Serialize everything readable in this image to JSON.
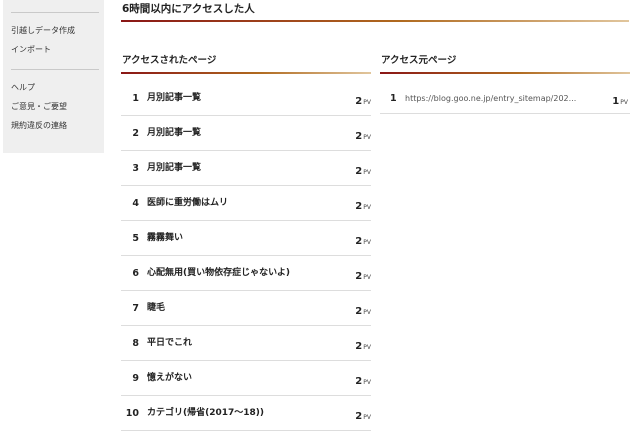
{
  "sidebar": {
    "items": [
      {
        "label": "引越しデータ作成"
      },
      {
        "label": "インポート"
      },
      {
        "label": "ヘルプ"
      },
      {
        "label": "ご意見・ご要望"
      },
      {
        "label": "規約違反の連絡"
      }
    ]
  },
  "header": {
    "title": "6時間以内にアクセスした人"
  },
  "accessed_pages": {
    "title": "アクセスされたページ",
    "rows": [
      {
        "rank": "1",
        "name": "月別記事一覧",
        "pv": "2",
        "unit": "PV"
      },
      {
        "rank": "2",
        "name": "月別記事一覧",
        "pv": "2",
        "unit": "PV"
      },
      {
        "rank": "3",
        "name": "月別記事一覧",
        "pv": "2",
        "unit": "PV"
      },
      {
        "rank": "4",
        "name": "医師に重労働はムリ",
        "pv": "2",
        "unit": "PV"
      },
      {
        "rank": "5",
        "name": "霧霧舞い",
        "pv": "2",
        "unit": "PV"
      },
      {
        "rank": "6",
        "name": "心配無用(買い物依存症じゃないよ)",
        "pv": "2",
        "unit": "PV"
      },
      {
        "rank": "7",
        "name": "睫毛",
        "pv": "2",
        "unit": "PV"
      },
      {
        "rank": "8",
        "name": "平日でこれ",
        "pv": "2",
        "unit": "PV"
      },
      {
        "rank": "9",
        "name": "憶えがない",
        "pv": "2",
        "unit": "PV"
      },
      {
        "rank": "10",
        "name": "カテゴリ(帰省(2017〜18))",
        "pv": "2",
        "unit": "PV"
      }
    ]
  },
  "referrers": {
    "title": "アクセス元ページ",
    "rows": [
      {
        "rank": "1",
        "url": "https://blog.goo.ne.jp/entry_sitemap/202...",
        "pv": "1",
        "unit": "PV"
      }
    ]
  }
}
